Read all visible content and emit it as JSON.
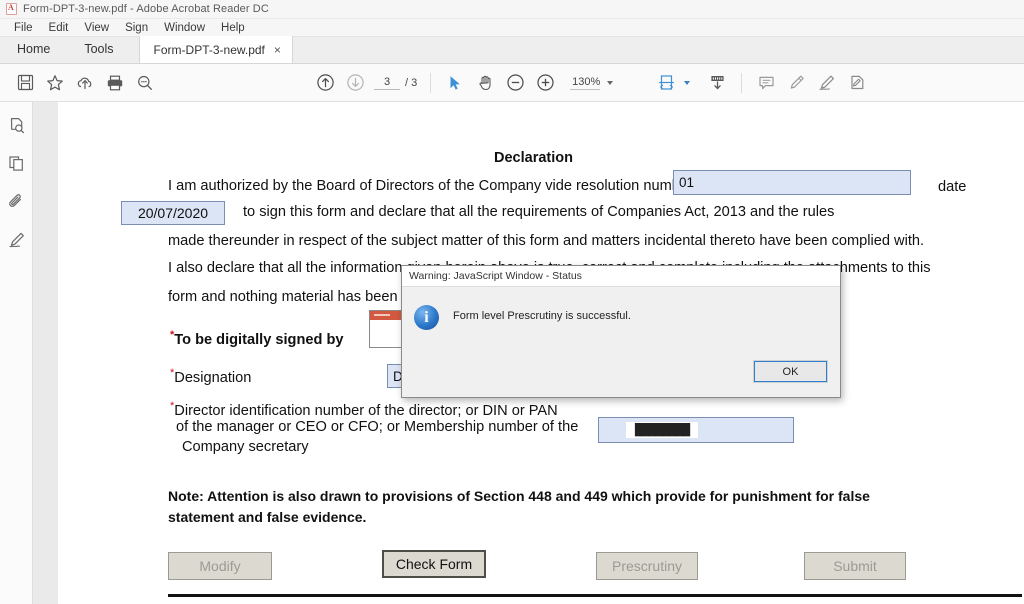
{
  "window": {
    "title": "Form-DPT-3-new.pdf - Adobe Acrobat Reader DC",
    "app_icon": "pdf-file-icon"
  },
  "menu": {
    "items": [
      {
        "label": "File"
      },
      {
        "label": "Edit"
      },
      {
        "label": "View"
      },
      {
        "label": "Sign"
      },
      {
        "label": "Window"
      },
      {
        "label": "Help"
      }
    ]
  },
  "tabs": {
    "home_label": "Home",
    "tools_label": "Tools",
    "document_label": "Form-DPT-3-new.pdf",
    "close_glyph": "×"
  },
  "toolbar": {
    "left_icons": [
      {
        "name": "save-icon"
      },
      {
        "name": "star-bookmark-icon"
      },
      {
        "name": "upload-cloud-icon"
      },
      {
        "name": "print-icon"
      },
      {
        "name": "search-icon"
      }
    ],
    "nav": {
      "previous_page_icon": "arrow-up-circle-icon",
      "next_page_icon": "arrow-down-circle-icon",
      "current_page": "3",
      "page_separator": "/ 3",
      "total_pages": "3"
    },
    "tools": {
      "select_icon": "cursor-select-icon",
      "hand_icon": "hand-pan-icon",
      "zoom_out_icon": "zoom-out-icon",
      "zoom_in_icon": "zoom-in-icon",
      "zoom_level": "130%"
    },
    "right_icons": [
      {
        "name": "fit-page-icon"
      },
      {
        "name": "scroll-down-icon"
      },
      {
        "name": "comment-icon"
      },
      {
        "name": "highlight-icon"
      },
      {
        "name": "draw-icon"
      },
      {
        "name": "sign-icon"
      }
    ]
  },
  "left_rail": {
    "items": [
      {
        "name": "page-thumbnails-icon"
      },
      {
        "name": "pages-icon"
      },
      {
        "name": "attachments-icon"
      },
      {
        "name": "signature-icon"
      }
    ],
    "collapse_icon": "chevron-left-icon"
  },
  "document": {
    "heading": "Declaration",
    "lines": [
      "I am authorized by the Board of Directors of the Company vide resolution number",
      "date",
      "dated",
      "to sign this form and declare that  all the requirements  of  Companies Act, 2013 and  the rules",
      "made thereunder in respect of  the subject  matter of this form and matters incidental thereto have been complied with.",
      "I also declare that all the information given herein above is true, correct and complete including the attachments to this",
      "form and nothing material has been suppressed."
    ],
    "line_fragments": {
      "line3_right": "ts to this"
    },
    "fields": {
      "resolution_number": {
        "label_prefix": "resolution number",
        "value": "01"
      },
      "dated": {
        "label": "dated",
        "value": "20/07/2020"
      },
      "signed_by": {
        "label": "To be digitally signed by",
        "value": ""
      },
      "designation": {
        "label": "Designation",
        "value": "Dir"
      },
      "din": {
        "label_line1": "Director identification number  of the director; or DIN or PAN",
        "label_line2": "of the manager or CEO or CFO; or Membership number of the",
        "label_line3": "Company secretary",
        "value": "████████"
      }
    },
    "note": "Note: Attention is also drawn to provisions of Section 448 and 449 which provide for punishment for false statement and false evidence.",
    "buttons": [
      {
        "label": "Modify",
        "state": "disabled"
      },
      {
        "label": "Check Form",
        "state": "enabled"
      },
      {
        "label": "Prescrutiny",
        "state": "disabled"
      },
      {
        "label": "Submit",
        "state": "disabled"
      }
    ]
  },
  "dialog": {
    "title": "Warning: JavaScript Window - Status",
    "message": "Form level Prescrutiny is successful.",
    "icon": "info-icon",
    "icon_glyph": "i",
    "ok_label": "OK"
  },
  "colors": {
    "accent_blue": "#2f7fd0",
    "field_blue": "#dce5f5",
    "field_border": "#7b8db0",
    "required_red": "#d0121b",
    "button_face": "#dcd9d0"
  }
}
